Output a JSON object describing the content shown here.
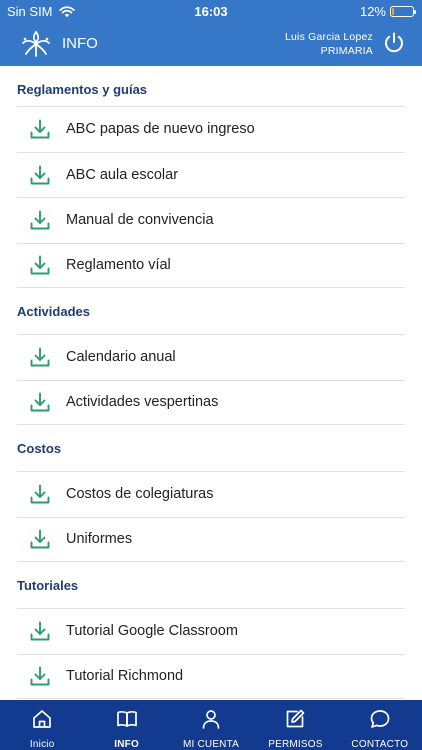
{
  "status_bar": {
    "carrier": "Sin SIM",
    "time": "16:03",
    "battery": "12%",
    "battery_level": 0.12
  },
  "header": {
    "title": "INFO",
    "user_name": "Luis Garcia Lopez",
    "user_level": "PRIMARIA"
  },
  "sections": [
    {
      "title": "Reglamentos y guías",
      "items": [
        "ABC papas de nuevo ingreso",
        "ABC aula escolar",
        "Manual de convivencia",
        "Reglamento víal"
      ]
    },
    {
      "title": "Actividades",
      "items": [
        "Calendario anual",
        "Actividades vespertinas"
      ]
    },
    {
      "title": "Costos",
      "items": [
        "Costos de colegiaturas",
        "Uniformes"
      ]
    },
    {
      "title": "Tutoriales",
      "items": [
        "Tutorial Google Classroom",
        "Tutorial Richmond"
      ]
    }
  ],
  "tabs": [
    {
      "label": "Inicio",
      "icon": "home-icon"
    },
    {
      "label": "INFO",
      "icon": "book-icon",
      "active": true
    },
    {
      "label": "MI CUENTA",
      "icon": "person-icon"
    },
    {
      "label": "PERMISOS",
      "icon": "edit-icon"
    },
    {
      "label": "CONTACTO",
      "icon": "chat-icon"
    }
  ],
  "colors": {
    "header": "#3777c8",
    "tabbar": "#123a8e",
    "section_title": "#1f3d73",
    "download_icon": "#2a9d6f",
    "battery": "#f5a623"
  }
}
